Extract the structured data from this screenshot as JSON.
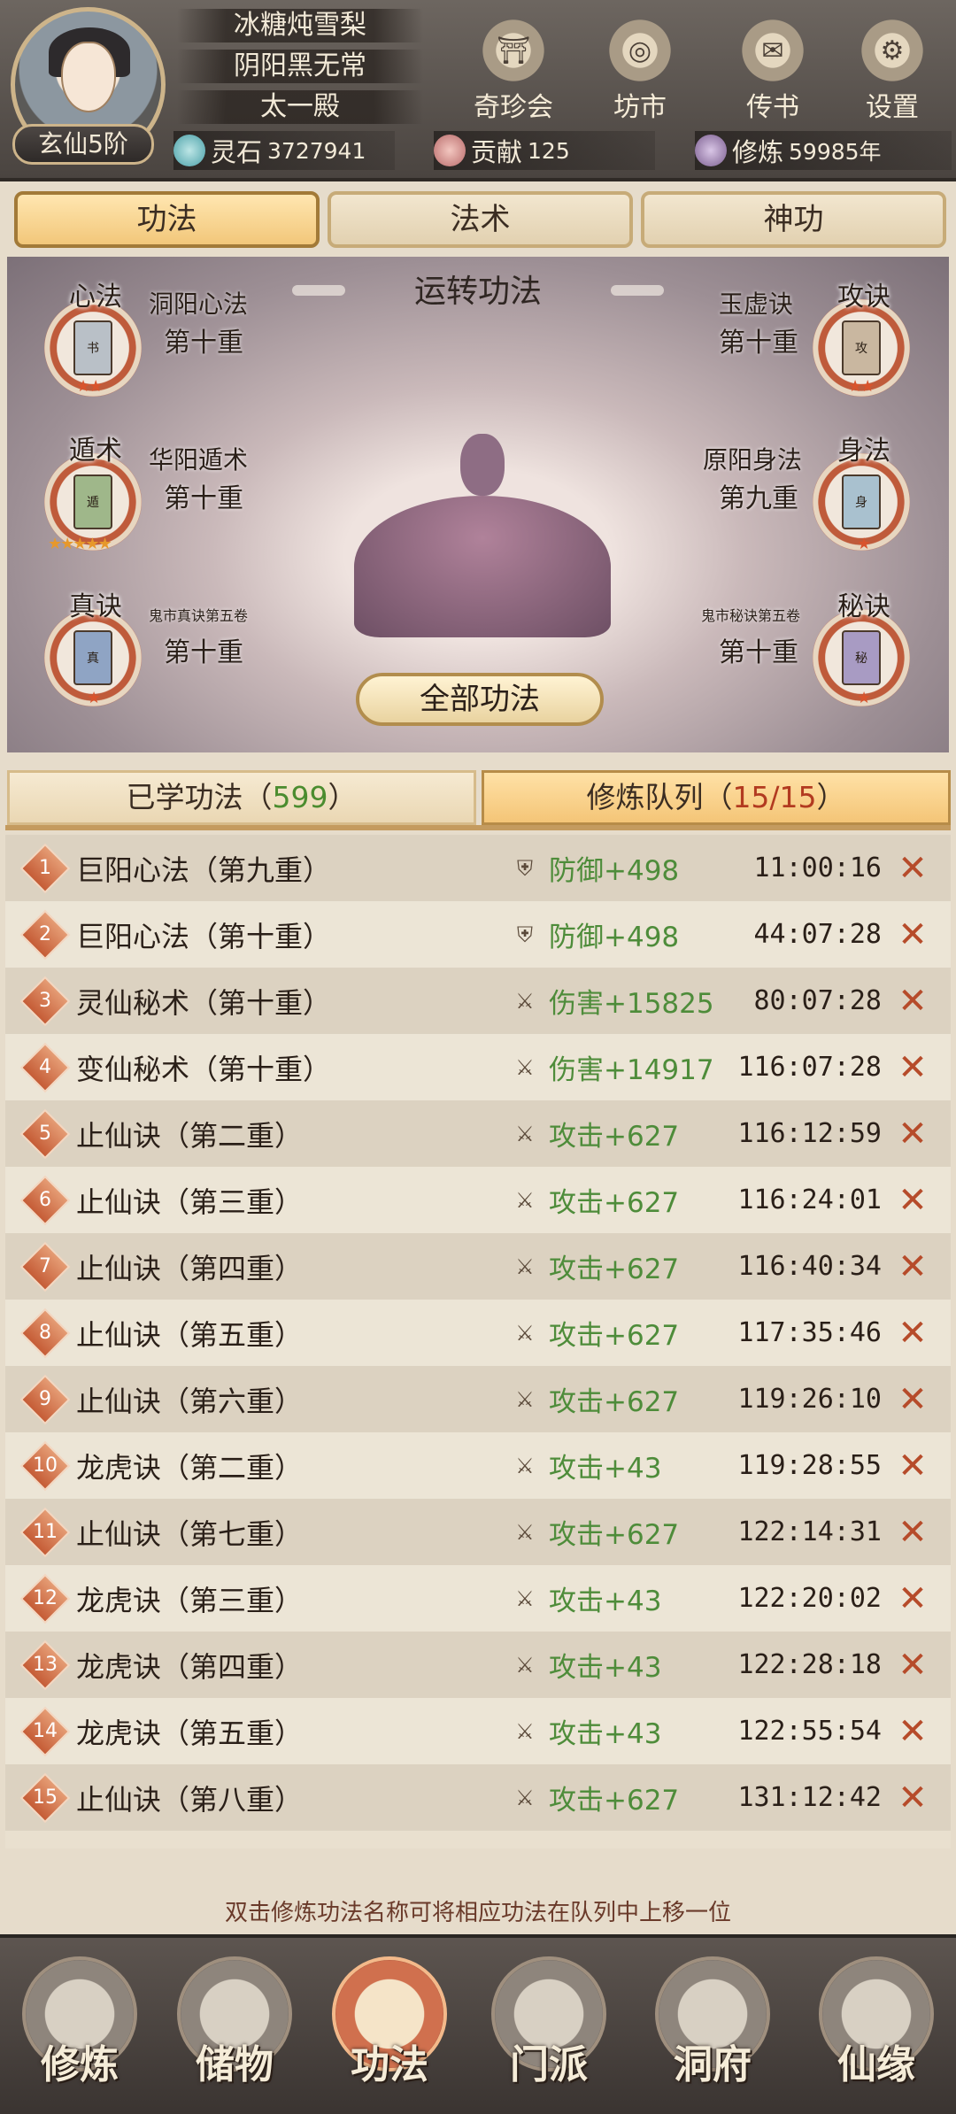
{
  "header": {
    "rank": "玄仙5阶",
    "player_name": "冰糖炖雪梨",
    "title": "阴阳黑无常",
    "sect": "太一殿",
    "top_buttons": [
      {
        "name": "qizhenhui-button",
        "label": "奇珍会",
        "icon": "treasure-icon"
      },
      {
        "name": "fangshi-button",
        "label": "坊市",
        "icon": "market-icon"
      },
      {
        "name": "chuanshu-button",
        "label": "传书",
        "icon": "letter-icon"
      },
      {
        "name": "settings-button",
        "label": "设置",
        "icon": "gear-icon"
      }
    ],
    "resources": {
      "spirit_stone_label": "灵石",
      "spirit_stone_value": "3727941",
      "contribution_label": "贡献",
      "contribution_value": "125",
      "cultivation_label": "修炼",
      "cultivation_value": "59985年"
    }
  },
  "category_tabs": [
    "功法",
    "法术",
    "神功"
  ],
  "meditation": {
    "title": "运转功法",
    "slots": [
      {
        "category": "心法",
        "name": "洞阳心法",
        "level": "第十重",
        "side": "left",
        "stars": "★★",
        "star_color": "red",
        "book_color": "#b9c0c7"
      },
      {
        "category": "遁术",
        "name": "华阳遁术",
        "level": "第十重",
        "side": "left",
        "stars": "★★★★★",
        "star_color": "gold",
        "book_color": "#9fb78a"
      },
      {
        "category": "真诀",
        "name": "鬼市真诀第五卷",
        "level": "第十重",
        "side": "left",
        "stars": "★",
        "star_color": "red",
        "book_color": "#8fa4c4"
      },
      {
        "category": "攻诀",
        "name": "玉虚诀",
        "level": "第十重",
        "side": "right",
        "stars": "★★",
        "star_color": "red",
        "book_color": "#c9b7a0"
      },
      {
        "category": "身法",
        "name": "原阳身法",
        "level": "第九重",
        "side": "right",
        "stars": "★",
        "star_color": "red",
        "book_color": "#a9c1cf"
      },
      {
        "category": "秘诀",
        "name": "鬼市秘诀第五卷",
        "level": "第十重",
        "side": "right",
        "stars": "★",
        "star_color": "red",
        "book_color": "#a89bc3"
      }
    ],
    "all_button": "全部功法"
  },
  "list_tabs": {
    "learned_label": "已学功法（",
    "learned_count": "599",
    "learned_suffix": "）",
    "queue_label": "修炼队列（",
    "queue_count": "15/15",
    "queue_suffix": "）"
  },
  "queue": [
    {
      "num": "1",
      "name": "巨阳心法",
      "level": "（第九重）",
      "effect": "防御+498",
      "time": "11:00:16",
      "icon": "shield-icon"
    },
    {
      "num": "2",
      "name": "巨阳心法",
      "level": "（第十重）",
      "effect": "防御+498",
      "time": "44:07:28",
      "icon": "shield-icon"
    },
    {
      "num": "3",
      "name": "灵仙秘术",
      "level": "（第十重）",
      "effect": "伤害+15825",
      "time": "80:07:28",
      "icon": "sword-icon"
    },
    {
      "num": "4",
      "name": "变仙秘术",
      "level": "（第十重）",
      "effect": "伤害+14917",
      "time": "116:07:28",
      "icon": "sword-icon"
    },
    {
      "num": "5",
      "name": "止仙诀",
      "level": "（第二重）",
      "effect": "攻击+627",
      "time": "116:12:59",
      "icon": "sword-icon"
    },
    {
      "num": "6",
      "name": "止仙诀",
      "level": "（第三重）",
      "effect": "攻击+627",
      "time": "116:24:01",
      "icon": "sword-icon"
    },
    {
      "num": "7",
      "name": "止仙诀",
      "level": "（第四重）",
      "effect": "攻击+627",
      "time": "116:40:34",
      "icon": "sword-icon"
    },
    {
      "num": "8",
      "name": "止仙诀",
      "level": "（第五重）",
      "effect": "攻击+627",
      "time": "117:35:46",
      "icon": "sword-icon"
    },
    {
      "num": "9",
      "name": "止仙诀",
      "level": "（第六重）",
      "effect": "攻击+627",
      "time": "119:26:10",
      "icon": "sword-icon"
    },
    {
      "num": "10",
      "name": "龙虎诀",
      "level": "（第二重）",
      "effect": "攻击+43",
      "time": "119:28:55",
      "icon": "sword-icon"
    },
    {
      "num": "11",
      "name": "止仙诀",
      "level": "（第七重）",
      "effect": "攻击+627",
      "time": "122:14:31",
      "icon": "sword-icon"
    },
    {
      "num": "12",
      "name": "龙虎诀",
      "level": "（第三重）",
      "effect": "攻击+43",
      "time": "122:20:02",
      "icon": "sword-icon"
    },
    {
      "num": "13",
      "name": "龙虎诀",
      "level": "（第四重）",
      "effect": "攻击+43",
      "time": "122:28:18",
      "icon": "sword-icon"
    },
    {
      "num": "14",
      "name": "龙虎诀",
      "level": "（第五重）",
      "effect": "攻击+43",
      "time": "122:55:54",
      "icon": "sword-icon"
    },
    {
      "num": "15",
      "name": "止仙诀",
      "level": "（第八重）",
      "effect": "攻击+627",
      "time": "131:12:42",
      "icon": "sword-icon"
    }
  ],
  "hint": "双击修炼功法名称可将相应功法在队列中上移一位",
  "bottom_nav": [
    {
      "name": "nav-xiulian",
      "label": "修炼",
      "active": false
    },
    {
      "name": "nav-chuwu",
      "label": "储物",
      "active": false
    },
    {
      "name": "nav-gongfa",
      "label": "功法",
      "active": true
    },
    {
      "name": "nav-menpai",
      "label": "门派",
      "active": false
    },
    {
      "name": "nav-dongfu",
      "label": "洞府",
      "active": false
    },
    {
      "name": "nav-xianyuan",
      "label": "仙缘",
      "active": false
    }
  ]
}
